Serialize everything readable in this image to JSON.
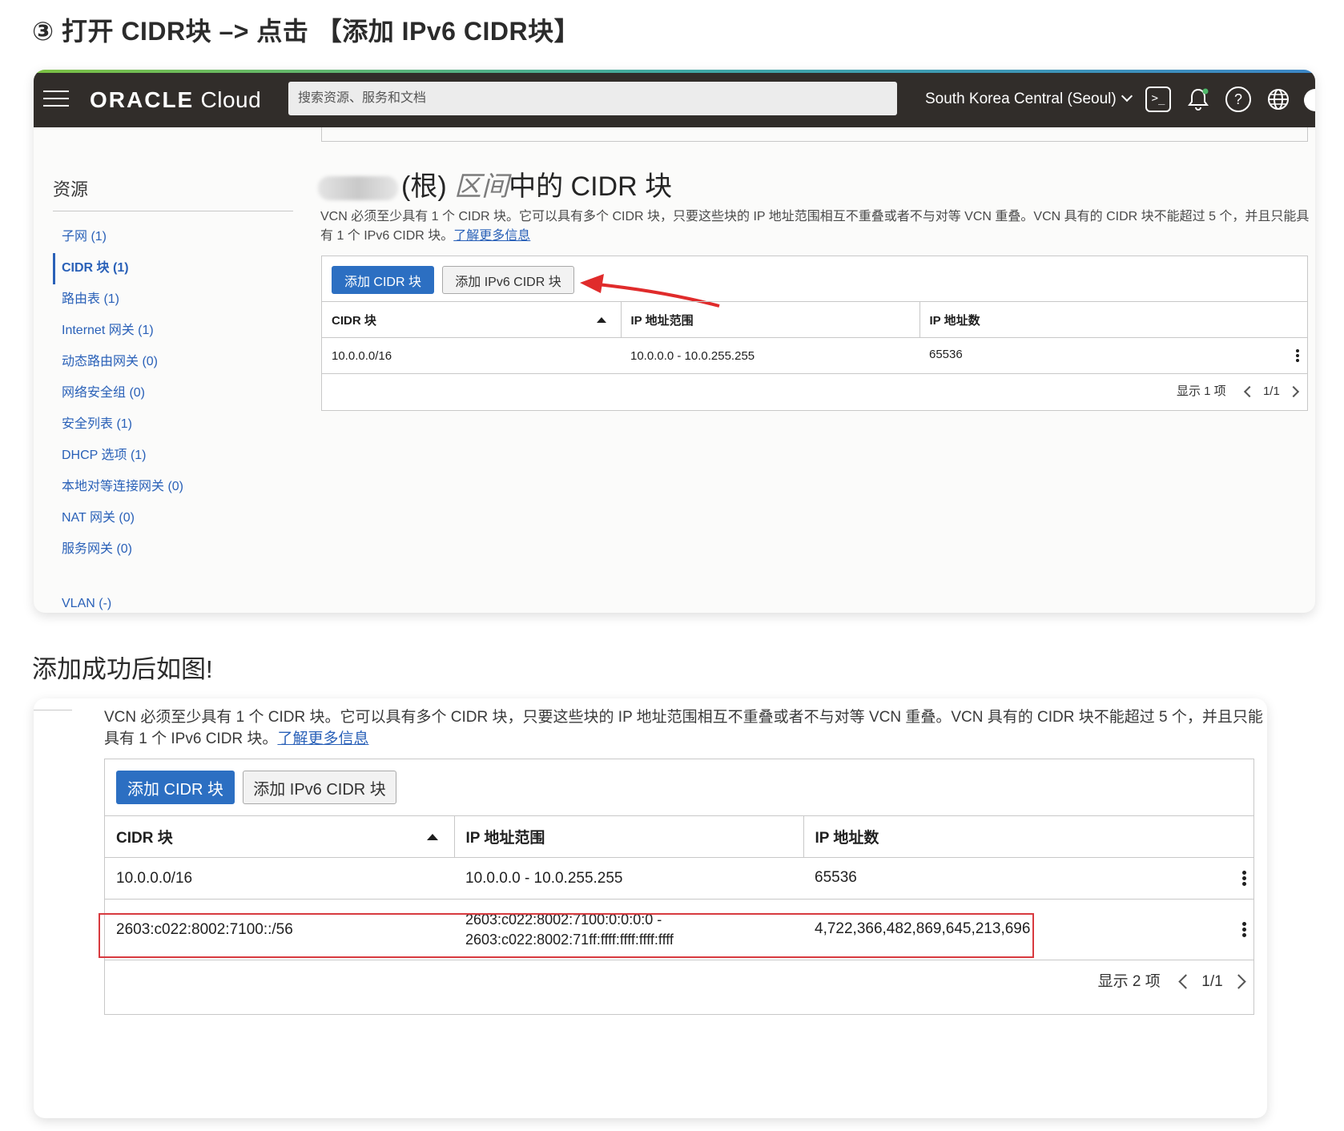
{
  "step_heading": "③ 打开 CIDR块 –> 点击 【添加 IPv6 CIDR块】",
  "console": {
    "brand_bold": "ORACLE",
    "brand_light": "Cloud",
    "search_placeholder": "搜索资源、服务和文档",
    "region": "South Korea Central (Seoul)",
    "terminal_glyph": ">_",
    "help_glyph": "?",
    "icons": [
      "menu-icon",
      "cloud-shell-icon",
      "bell-icon",
      "help-icon",
      "globe-icon",
      "avatar-icon"
    ],
    "accent_color": "#2c6fc2"
  },
  "sidebar": {
    "title": "资源",
    "items": [
      {
        "label": "子网 (1)"
      },
      {
        "label": "CIDR 块 (1)",
        "active": true
      },
      {
        "label": "路由表 (1)"
      },
      {
        "label": "Internet 网关 (1)"
      },
      {
        "label": "动态路由网关 (0)"
      },
      {
        "label": "网络安全组 (0)"
      },
      {
        "label": "安全列表 (1)"
      },
      {
        "label": "DHCP 选项 (1)"
      },
      {
        "label": "本地对等连接网关 (0)"
      },
      {
        "label": "NAT 网关 (0)"
      },
      {
        "label": "服务网关 (0)"
      }
    ],
    "more": "VLAN (-)"
  },
  "page": {
    "title_root": "(根)",
    "title_compartment": "区间",
    "title_suffix": "中的 CIDR 块",
    "description": "VCN 必须至少具有 1 个 CIDR 块。它可以具有多个 CIDR 块，只要这些块的 IP 地址范围相互不重叠或者不与对等 VCN 重叠。VCN 具有的 CIDR 块不能超过 5 个，并且只能具有 1 个 IPv6 CIDR 块。",
    "learn_more": "了解更多信息"
  },
  "buttons": {
    "add_cidr": "添加 CIDR 块",
    "add_ipv6": "添加 IPv6 CIDR 块"
  },
  "table_headers": {
    "cidr": "CIDR 块",
    "ip_range": "IP 地址范围",
    "ip_count": "IP 地址数"
  },
  "table_before": {
    "rows": [
      {
        "cidr": "10.0.0.0/16",
        "range": "10.0.0.0 - 10.0.255.255",
        "count": "65536"
      }
    ],
    "showing": "显示 1 项",
    "page": "1/1"
  },
  "caption": "添加成功后如图!",
  "table_after": {
    "rows": [
      {
        "cidr": "10.0.0.0/16",
        "range": "10.0.0.0 - 10.0.255.255",
        "count": "65536"
      },
      {
        "cidr": "2603:c022:8002:7100::/56",
        "range": "2603:c022:8002:7100:0:0:0:0 - 2603:c022:8002:71ff:ffff:ffff:ffff:ffff",
        "count": "4,722,366,482,869,645,213,696"
      }
    ],
    "showing": "显示 2 项",
    "page": "1/1"
  },
  "annotation_colors": {
    "arrow": "#e02b2b",
    "highlight": "#d83a3f"
  }
}
